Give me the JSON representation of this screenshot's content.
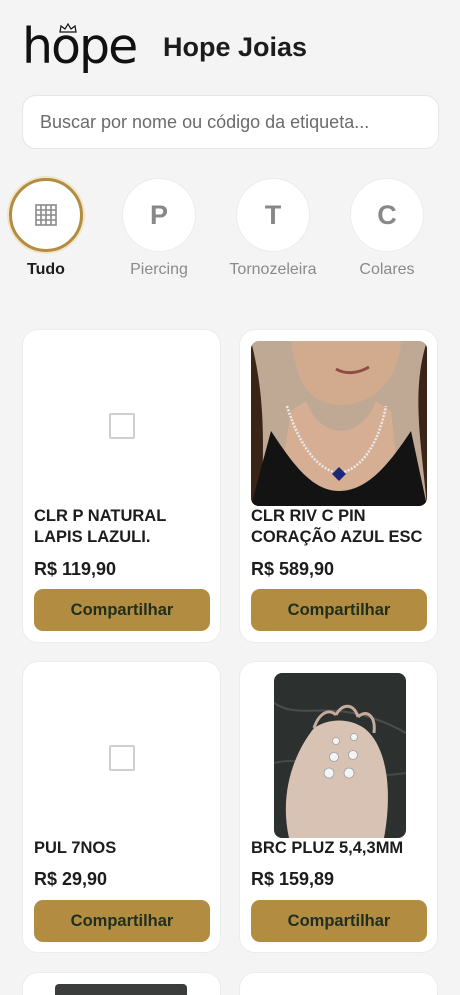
{
  "header": {
    "logo_text": "hope",
    "brand_name": "Hope Joias"
  },
  "search": {
    "placeholder": "Buscar por nome ou código da etiqueta..."
  },
  "categories": [
    {
      "label": "Tudo",
      "icon": "grid-icon",
      "letter": "",
      "active": true
    },
    {
      "label": "Piercing",
      "letter": "P",
      "active": false
    },
    {
      "label": "Tornozeleira",
      "letter": "T",
      "active": false
    },
    {
      "label": "Colares",
      "letter": "C",
      "active": false
    }
  ],
  "products": [
    {
      "name": "CLR P NATURAL LAPIS LAZULI.",
      "price": "R$ 119,90",
      "image": "placeholder"
    },
    {
      "name": "CLR RIV C PIN CORAÇÃO AZUL ESC",
      "price": "R$ 589,90",
      "image": "woman-with-necklace-photo"
    },
    {
      "name": "PUL 7NOS",
      "price": "R$ 29,90",
      "image": "placeholder"
    },
    {
      "name": "BRC PLUZ 5,4,3MM",
      "price": "R$ 159,89",
      "image": "earrings-on-hand-photo"
    }
  ],
  "share_label": "Compartilhar",
  "colors": {
    "accent": "#b28c41",
    "background": "#f4f4f5",
    "card": "#ffffff"
  }
}
